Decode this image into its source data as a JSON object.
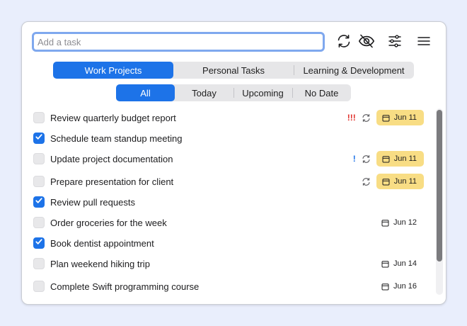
{
  "search": {
    "placeholder": "Add a task",
    "value": ""
  },
  "toolbar": {
    "icons": [
      "sync-icon",
      "eye-slash-icon",
      "sliders-icon",
      "menu-icon"
    ]
  },
  "categories": {
    "tabs": [
      "Work Projects",
      "Personal Tasks",
      "Learning & Development"
    ],
    "selected": "Work Projects"
  },
  "filters": {
    "tabs": [
      "All",
      "Today",
      "Upcoming",
      "No Date"
    ],
    "selected": "All"
  },
  "tasks": [
    {
      "title": "Review quarterly budget report",
      "checked": false,
      "priority": "!!!",
      "repeat": true,
      "date": "Jun 11",
      "highlight": true
    },
    {
      "title": "Schedule team standup meeting",
      "checked": true,
      "priority": "",
      "repeat": false,
      "date": "",
      "highlight": false
    },
    {
      "title": "Update project documentation",
      "checked": false,
      "priority": "!",
      "repeat": true,
      "date": "Jun 11",
      "highlight": true
    },
    {
      "title": "Prepare presentation for client",
      "checked": false,
      "priority": "",
      "repeat": true,
      "date": "Jun 11",
      "highlight": true
    },
    {
      "title": "Review pull requests",
      "checked": true,
      "priority": "",
      "repeat": false,
      "date": "",
      "highlight": false
    },
    {
      "title": "Order groceries for the week",
      "checked": false,
      "priority": "",
      "repeat": false,
      "date": "Jun 12",
      "highlight": false
    },
    {
      "title": "Book dentist appointment",
      "checked": true,
      "priority": "",
      "repeat": false,
      "date": "",
      "highlight": false
    },
    {
      "title": "Plan weekend hiking trip",
      "checked": false,
      "priority": "",
      "repeat": false,
      "date": "Jun 14",
      "highlight": false
    },
    {
      "title": "Complete Swift programming course",
      "checked": false,
      "priority": "",
      "repeat": false,
      "date": "Jun 16",
      "highlight": false
    }
  ],
  "colors": {
    "accent": "#1d73e8",
    "date_highlight": "#f8dd84",
    "priority_high": "#e0312c",
    "priority_low": "#1d73e8"
  }
}
